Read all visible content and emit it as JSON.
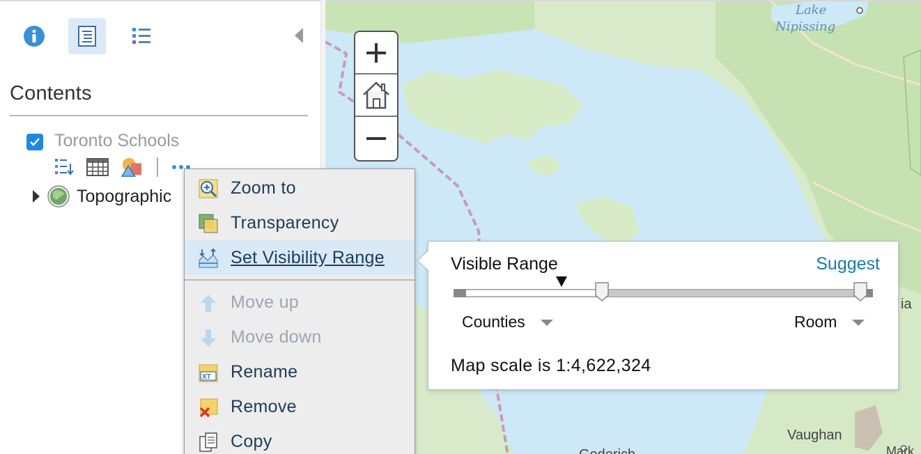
{
  "sidebar": {
    "tabs": [
      {
        "name": "details",
        "icon": "info-icon",
        "active": false
      },
      {
        "name": "contents",
        "icon": "contents-icon",
        "active": true
      },
      {
        "name": "legend",
        "icon": "legend-list-icon",
        "active": false
      }
    ],
    "title": "Contents",
    "layers": [
      {
        "label": "Toronto Schools",
        "checked": true
      },
      {
        "label": "Topographic",
        "type": "basemap"
      }
    ],
    "layer_tools": [
      "show-legend-icon",
      "attribute-table-icon",
      "change-style-icon",
      "more-options-icon"
    ]
  },
  "zoom": {
    "zoom_in": "+",
    "home_icon": "home-icon",
    "zoom_out": "−"
  },
  "context_menu": {
    "items": [
      {
        "label": "Zoom to",
        "icon": "zoom-to-icon",
        "enabled": true
      },
      {
        "label": "Transparency",
        "icon": "transparency-icon",
        "enabled": true
      },
      {
        "label": "Set Visibility Range",
        "icon": "visibility-range-icon",
        "enabled": true,
        "active": true
      },
      {
        "label": "Move up",
        "icon": "arrow-up-icon",
        "enabled": false
      },
      {
        "label": "Move down",
        "icon": "arrow-down-icon",
        "enabled": false
      },
      {
        "label": "Rename",
        "icon": "rename-icon",
        "enabled": true
      },
      {
        "label": "Remove",
        "icon": "remove-icon",
        "enabled": true
      },
      {
        "label": "Copy",
        "icon": "copy-icon",
        "enabled": true
      }
    ]
  },
  "visibility_popup": {
    "title": "Visible Range",
    "suggest": "Suggest",
    "min_scale": "Counties",
    "max_scale": "Room",
    "scale_text": "Map scale is 1:4,622,324"
  },
  "map": {
    "labels": {
      "lake_nipissing_1": "Lake",
      "lake_nipissing_2": "Nipissing",
      "vaughan": "Vaughan",
      "goderich": "Goderich",
      "markham": "Mark",
      "edge_label": "ia"
    }
  },
  "colors": {
    "accent": "#1e88e5",
    "link": "#1e7ba4",
    "water": "#cde8f6",
    "land": "#d7eac8",
    "menu_bg": "#ededed",
    "menu_active": "#d9e9f6"
  }
}
